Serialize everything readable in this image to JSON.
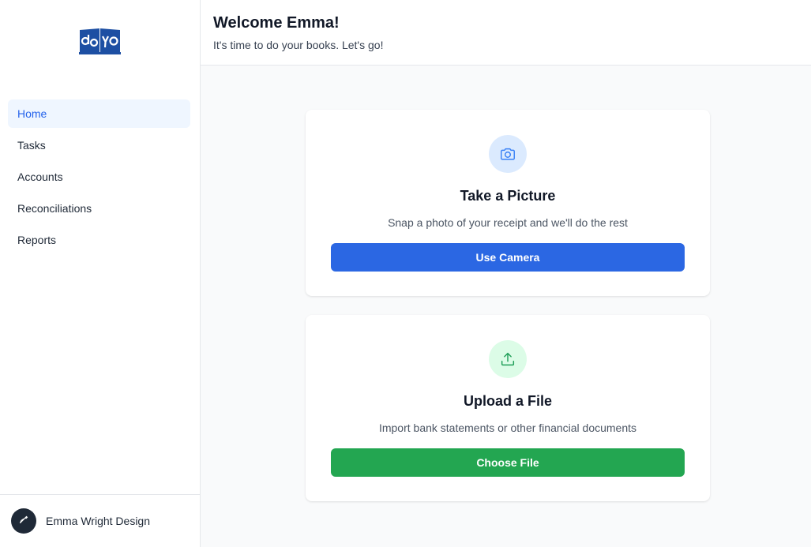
{
  "brand": {
    "logo_text": "doyo",
    "color": "#1d4fa3"
  },
  "sidebar": {
    "items": [
      {
        "label": "Home",
        "active": true
      },
      {
        "label": "Tasks"
      },
      {
        "label": "Accounts"
      },
      {
        "label": "Reconciliations"
      },
      {
        "label": "Reports"
      }
    ],
    "footer": {
      "org_name": "Emma Wright Design",
      "avatar_icon": "pen-nib-icon"
    }
  },
  "header": {
    "title": "Welcome Emma!",
    "subtitle": "It's time to do your books. Let's go!"
  },
  "cards": {
    "camera": {
      "icon": "camera-icon",
      "title": "Take a Picture",
      "description": "Snap a photo of your receipt and we'll do the rest",
      "button_label": "Use Camera",
      "accent": "#2b67e3"
    },
    "upload": {
      "icon": "upload-icon",
      "title": "Upload a File",
      "description": "Import bank statements or other financial documents",
      "button_label": "Choose File",
      "accent": "#23a651"
    }
  }
}
